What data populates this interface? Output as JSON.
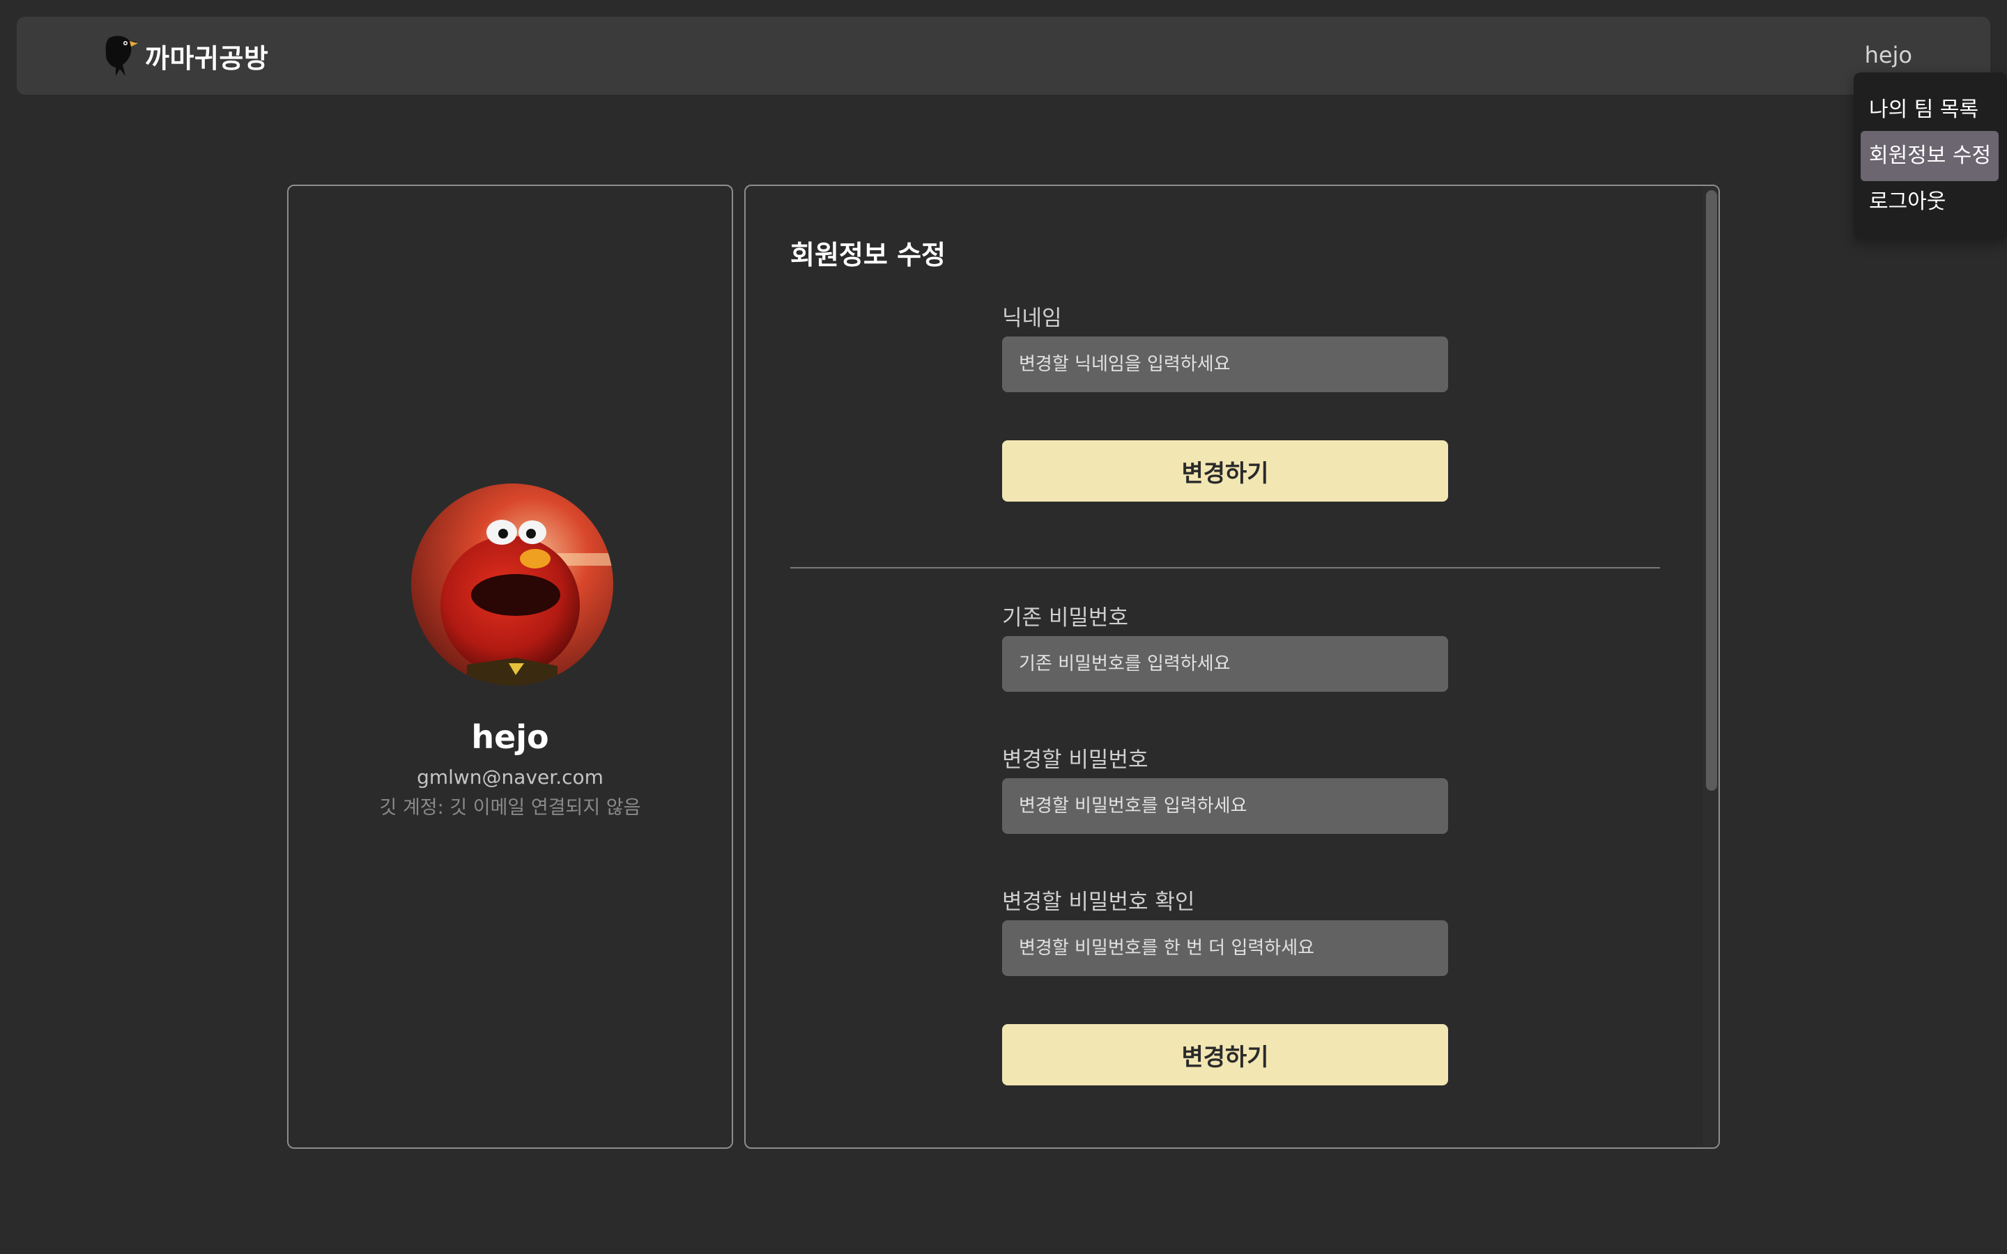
{
  "app": {
    "brand": "까마귀공방",
    "logo_icon": "crow-icon"
  },
  "header": {
    "user_name": "hejo"
  },
  "user_menu": {
    "items": [
      {
        "label": "나의 팀 목록",
        "active": false
      },
      {
        "label": "회원정보 수정",
        "active": true
      },
      {
        "label": "로그아웃",
        "active": false
      }
    ]
  },
  "profile": {
    "name": "hejo",
    "email": "gmlwn@naver.com",
    "git_account": "깃 계정:  깃 이메일 연결되지 않음",
    "avatar_icon": "avatar-image"
  },
  "edit": {
    "title": "회원정보 수정",
    "nickname": {
      "label": "닉네임",
      "placeholder": "변경할 닉네임을 입력하세요",
      "value": ""
    },
    "nickname_submit": "변경하기",
    "current_password": {
      "label": "기존 비밀번호",
      "placeholder": "기존 비밀번호를 입력하세요",
      "value": ""
    },
    "new_password": {
      "label": "변경할 비밀번호",
      "placeholder": "변경할 비밀번호를 입력하세요",
      "value": ""
    },
    "confirm_password": {
      "label": "변경할 비밀번호 확인",
      "placeholder": "변경할 비밀번호를 한 번 더 입력하세요",
      "value": ""
    },
    "password_submit": "변경하기"
  },
  "colors": {
    "background": "#2b2b2b",
    "header": "#3b3b3b",
    "button": "#f2e6b3",
    "input": "#626262",
    "menu_active": "#6b6670"
  }
}
